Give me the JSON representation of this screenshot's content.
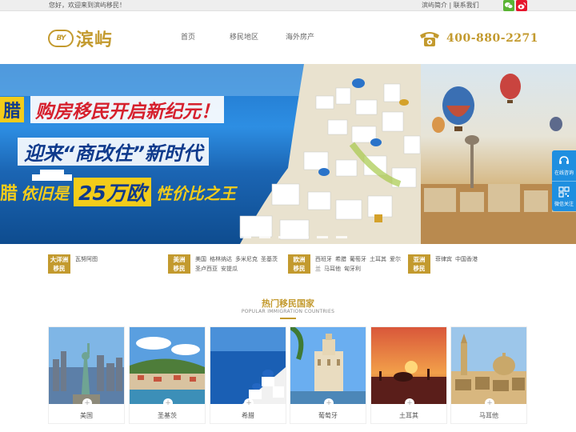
{
  "topbar": {
    "welcome": "您好，欢迎来到滨屿移民！",
    "about": "滨屿简介",
    "separator": "|",
    "contact": "联系我们"
  },
  "header": {
    "logo_mark": "BY",
    "logo_name": "滨屿",
    "nav": [
      "首页",
      "移民地区",
      "海外房产"
    ],
    "phone": "400-880-2271"
  },
  "banner": {
    "headline_1_left": "腊",
    "headline_1": "购房移民开启新纪元！",
    "headline_2": "迎来“商改住”新时代",
    "headline_3_left": "腊",
    "headline_3a": "依旧是",
    "headline_3b": "25万欧",
    "headline_3c": "性价比之王"
  },
  "side_tools": {
    "consult": "在线咨询",
    "follow": "微信关注"
  },
  "regions": [
    {
      "badge_line1": "大洋洲",
      "badge_line2": "移民",
      "countries": [
        "瓦努阿图"
      ]
    },
    {
      "badge_line1": "美洲",
      "badge_line2": "移民",
      "countries": [
        "美国",
        "格林纳达",
        "多米尼克",
        "圣基茨",
        "圣卢西亚",
        "安提瓜"
      ]
    },
    {
      "badge_line1": "欧洲",
      "badge_line2": "移民",
      "countries": [
        "西班牙",
        "希腊",
        "葡萄牙",
        "土耳其",
        "爱尔兰",
        "马耳他",
        "匈牙利"
      ]
    },
    {
      "badge_line1": "亚洲",
      "badge_line2": "移民",
      "countries": [
        "菲律宾",
        "中国香港"
      ]
    }
  ],
  "hot": {
    "title": "热门移民国家",
    "subtitle": "POPULAR IMMIGRATION COUNTRIES",
    "plus": "+",
    "cards": [
      "美国",
      "圣基茨",
      "希腊",
      "葡萄牙",
      "土耳其",
      "马耳他"
    ]
  },
  "colors": {
    "accent": "#c39a2e",
    "topbar": "#eeeeee",
    "tool_blue": "#1f8fe0"
  }
}
